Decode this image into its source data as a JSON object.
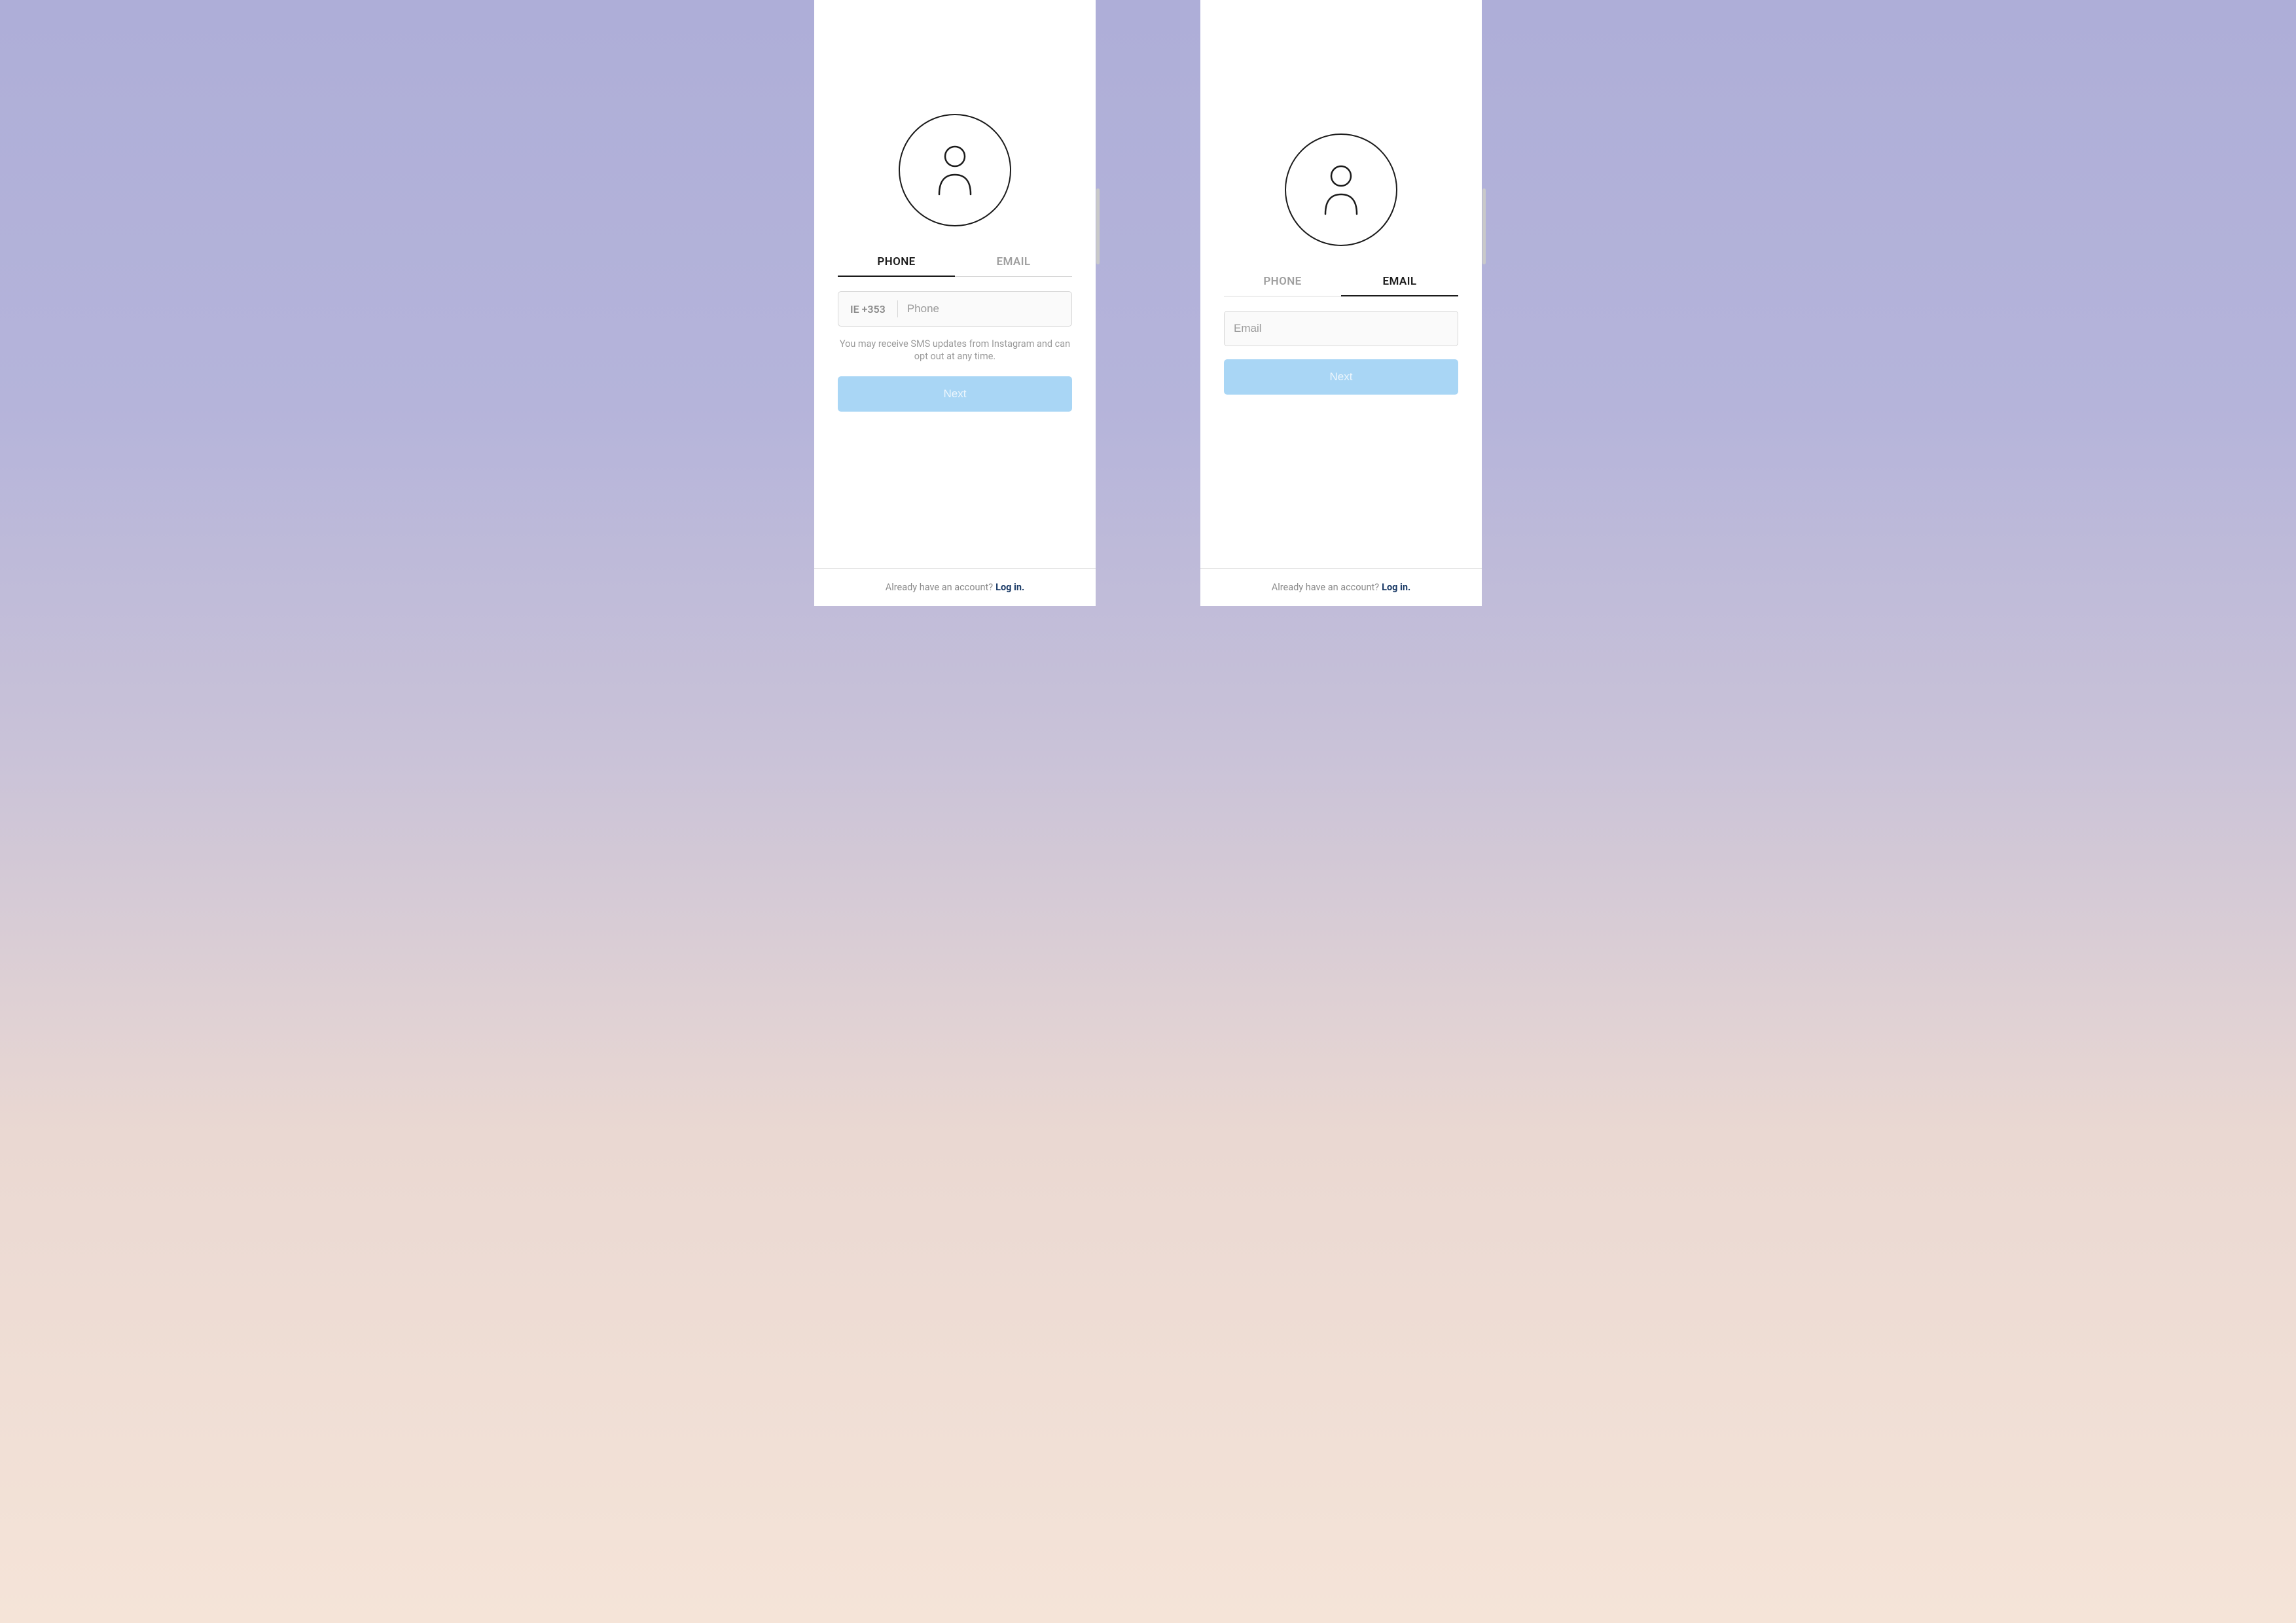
{
  "left": {
    "tabs": {
      "phone": "PHONE",
      "email": "EMAIL",
      "active": "phone"
    },
    "country_code": "IE +353",
    "phone_placeholder": "Phone",
    "helper_text": "You may receive SMS updates from Instagram and can opt out at any time.",
    "next_label": "Next",
    "footer_prompt": "Already have an account?",
    "footer_link": "Log in."
  },
  "right": {
    "tabs": {
      "phone": "PHONE",
      "email": "EMAIL",
      "active": "email"
    },
    "email_placeholder": "Email",
    "next_label": "Next",
    "footer_prompt": "Already have an account?",
    "footer_link": "Log in."
  }
}
